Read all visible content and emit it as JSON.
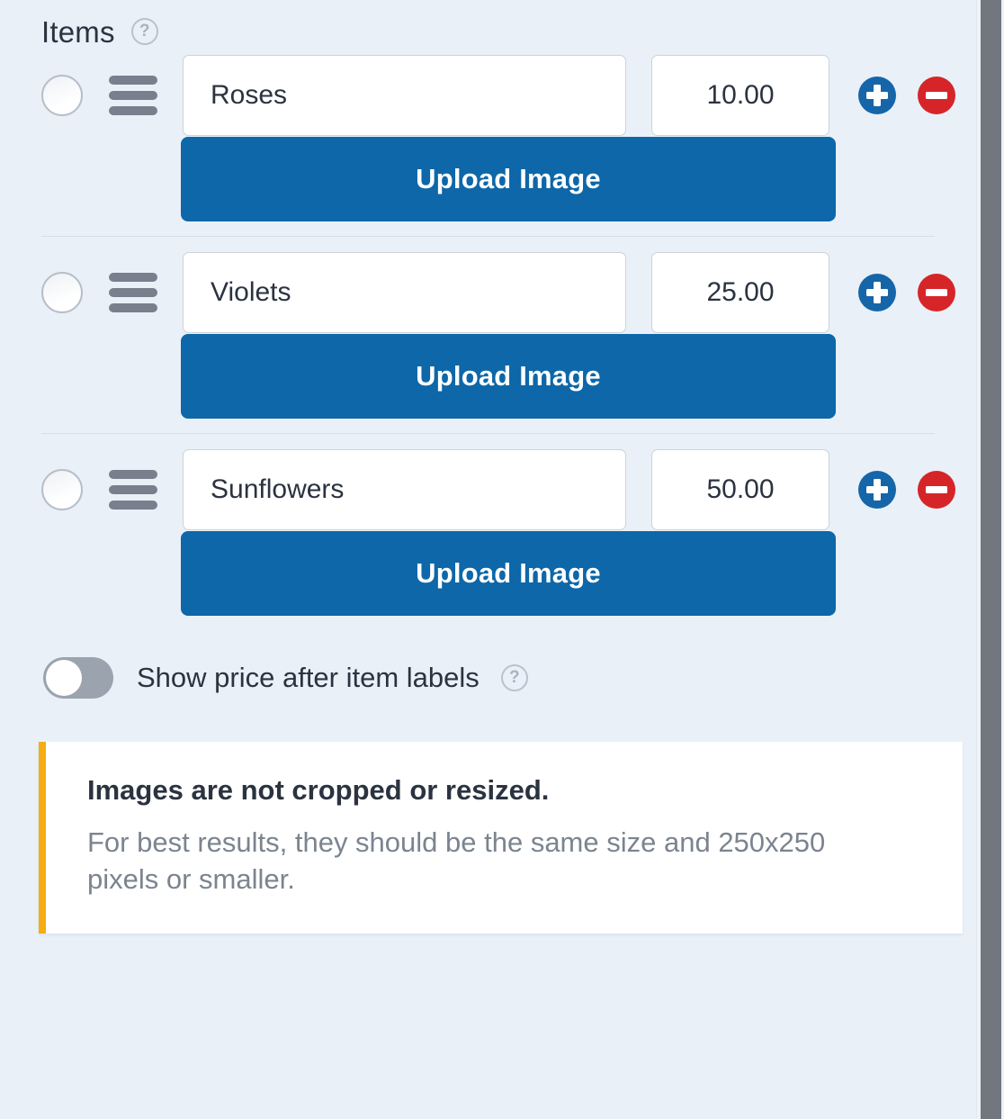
{
  "section": {
    "title": "Items",
    "help_icon": "help-circle-icon",
    "help_glyph": "?"
  },
  "items": [
    {
      "name": "Roses",
      "price": "10.00",
      "upload_label": "Upload Image",
      "radio_icon": "radio-unchecked-icon",
      "drag_icon": "drag-handle-icon",
      "add_icon": "plus-circle-icon",
      "remove_icon": "minus-circle-icon"
    },
    {
      "name": "Violets",
      "price": "25.00",
      "upload_label": "Upload Image",
      "radio_icon": "radio-unchecked-icon",
      "drag_icon": "drag-handle-icon",
      "add_icon": "plus-circle-icon",
      "remove_icon": "minus-circle-icon"
    },
    {
      "name": "Sunflowers",
      "price": "50.00",
      "upload_label": "Upload Image",
      "radio_icon": "radio-unchecked-icon",
      "drag_icon": "drag-handle-icon",
      "add_icon": "plus-circle-icon",
      "remove_icon": "minus-circle-icon"
    }
  ],
  "toggle": {
    "label": "Show price after item labels",
    "state": "off",
    "help_icon": "help-circle-icon",
    "help_glyph": "?"
  },
  "notice": {
    "title": "Images are not cropped or resized.",
    "body": "For best results, they should be the same size and 250x250 pixels or smaller."
  },
  "colors": {
    "background": "#e9f0f8",
    "upload_button": "#0d67a8",
    "add_button": "#1565a8",
    "remove_button": "#d62528",
    "notice_accent": "#f5ad13",
    "toggle_off_track": "#9aa3ae",
    "scrollbar_thumb": "#72777f",
    "text_primary": "#2b3340",
    "text_muted": "#7b848f"
  },
  "scrollbar": {
    "name": "vertical-scrollbar"
  }
}
